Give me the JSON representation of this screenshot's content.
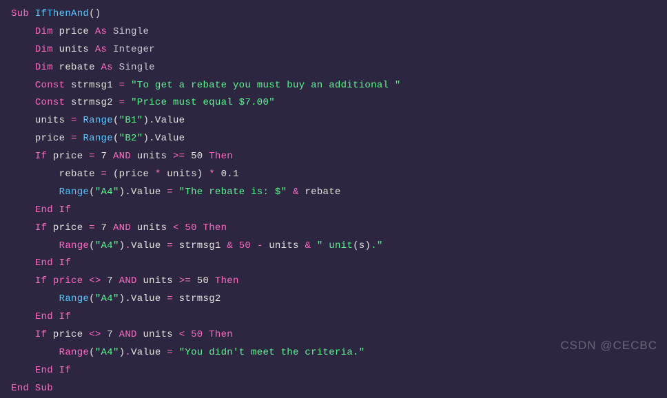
{
  "code": {
    "line1": {
      "kw_sub": "Sub",
      "name": "IfThenAnd"
    },
    "line2": {
      "kw_dim": "Dim",
      "var": "price",
      "kw_as": "As",
      "type": "Single"
    },
    "line3": {
      "kw_dim": "Dim",
      "var": "units",
      "kw_as": "As",
      "type": "Integer"
    },
    "line4": {
      "kw_dim": "Dim",
      "var": "rebate",
      "kw_as": "As",
      "type": "Single"
    },
    "line5": {
      "kw_const": "Const",
      "var": "strmsg1",
      "eq": " = ",
      "str": "\"To get a rebate you must buy an additional \""
    },
    "line6": {
      "kw_const": "Const",
      "var": "strmsg2",
      "eq": " = ",
      "str": "\"Price must equal $7.00\""
    },
    "line7": {
      "var": "units",
      "eq": " = ",
      "range": "Range",
      "paren": "(",
      "arg": "\"B1\"",
      "close": ")",
      "dot": ".Value"
    },
    "line8": {
      "var": "price",
      "eq": " = ",
      "range": "Range",
      "paren": "(",
      "arg": "\"B2\"",
      "close": ")",
      "dot": ".Value"
    },
    "line9": {
      "kw_if": "If",
      "expr1": " price ",
      "op1": "=",
      "num1": " 7 ",
      "kw_and": "AND",
      "expr2": " units ",
      "op2": ">=",
      "num2": " 50 ",
      "kw_then": "Then"
    },
    "line10": {
      "var": "rebate",
      "eq": " = ",
      "expr": "(price ",
      "op": "*",
      "expr2": " units) ",
      "op2": "*",
      "num": " 0.1"
    },
    "line11": {
      "range": "Range",
      "paren": "(",
      "arg": "\"A4\"",
      "close": ")",
      "dot": ".Value ",
      "eq": "=",
      "str": " \"The rebate is: $\"",
      "amp": " & ",
      "var": "rebate"
    },
    "line12": {
      "kw_endif": "End If"
    },
    "line13": {
      "kw_if": "If",
      "expr1": " price ",
      "op1": "=",
      "num1": " 7 ",
      "kw_and": "AND",
      "expr2": " units ",
      "op2": "<",
      "num2": " 50 ",
      "kw_then": "Then"
    },
    "line14": {
      "range": "Range",
      "paren": "(",
      "arg": "\"A4\"",
      "close": ")",
      "dot": ".",
      "value": "Value",
      "eq": " = ",
      "var1": "strmsg1",
      "amp1": " & ",
      "num": "50",
      "minus": " - ",
      "var2": "units",
      "amp2": " & ",
      "str": "\" unit",
      "paren2": "(",
      "s": "s",
      "close2": ")",
      "dot2": ".\""
    },
    "line15": {
      "kw_endif": "End If"
    },
    "line16": {
      "kw_if": "If",
      "price": " price",
      "op1": " <> ",
      "num1": "7",
      "kw_and": " AND ",
      "expr2": "units ",
      "op2": ">=",
      "num2": " 50 ",
      "kw_then": "Then"
    },
    "line17": {
      "range": "Range",
      "paren": "(",
      "arg": "\"A4\"",
      "close": ")",
      "dot": ".Value ",
      "eq": "=",
      "var": " strmsg2"
    },
    "line18": {
      "kw_endif": "End If"
    },
    "line19": {
      "kw_if": "If",
      "expr1": " price ",
      "op1": "<>",
      "num1": " 7 ",
      "kw_and": "AND",
      "expr2": " units ",
      "op2": "<",
      "num2": " 50 ",
      "kw_then": "Then"
    },
    "line20": {
      "range": "Range",
      "paren": "(",
      "arg": "\"A4\"",
      "close": ")",
      "dot": ".",
      "value": "Value",
      "eq": " = ",
      "str": "\"You didn't meet the criteria.\""
    },
    "line21": {
      "kw_endif": "End If"
    },
    "line22": {
      "kw_endsub": "End Sub"
    }
  },
  "watermark": "CSDN @CECBC"
}
